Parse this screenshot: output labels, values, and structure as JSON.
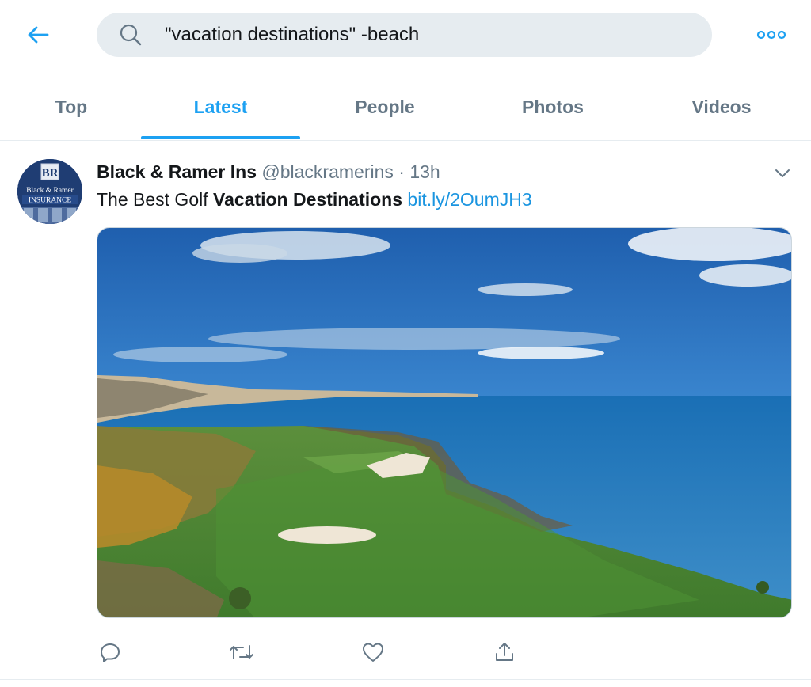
{
  "search": {
    "query": "\"vacation destinations\" -beach",
    "back_icon": "arrow-left-icon",
    "search_icon": "search-icon",
    "more_icon": "more-dots-icon"
  },
  "tabs": [
    {
      "label": "Top",
      "active": false
    },
    {
      "label": "Latest",
      "active": true
    },
    {
      "label": "People",
      "active": false
    },
    {
      "label": "Photos",
      "active": false
    },
    {
      "label": "Videos",
      "active": false
    }
  ],
  "tweet": {
    "avatar": {
      "logo_mark": "BR",
      "line1": "Black & Ramer",
      "line2": "INSURANCE"
    },
    "author_name": "Black & Ramer Ins",
    "handle": "@blackramerins",
    "separator": "·",
    "time": "13h",
    "text_plain": "The Best Golf ",
    "text_bold": "Vacation Destinations",
    "link": "bit.ly/2OumJH3",
    "media_description_icon": "photo",
    "actions": [
      "reply-icon",
      "retweet-icon",
      "like-icon",
      "share-icon"
    ]
  },
  "colors": {
    "accent": "#1da1f2",
    "link": "#1b95e0",
    "muted": "#657786",
    "search_bg": "#e6ecf0"
  }
}
